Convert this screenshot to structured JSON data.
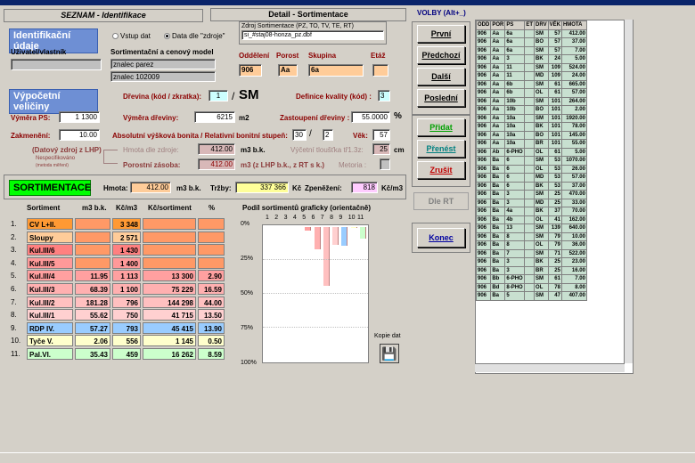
{
  "left_tab": "SEZNAM - Identifikace",
  "detail_tab": "Detail - Sortimentace",
  "voby": "VOLBY (Alt+_)",
  "ident": {
    "title": "Identifikační údaje",
    "radio1": "Vstup dat",
    "radio2": "Data dle \"zdroje\"",
    "source_label": "Zdroj Sortimentace (PZ, TO, TV, TE, RT)",
    "source_value": "si_#staj08-honza_pz.dbf",
    "owner_label": "Uživatel/vlastník",
    "owner_value": "",
    "model_label": "Sortimentační a cenový model",
    "model1": "znalec parez",
    "model2": "znalec 102009",
    "oddeleni_label": "Oddělení",
    "oddeleni": "906",
    "porost_label": "Porost",
    "porost": "Aa",
    "skupina_label": "Skupina",
    "skupina": "6a",
    "etaz_label": "Etáž",
    "etaz": ""
  },
  "calc": {
    "title": "Výpočetní veličiny",
    "drevina_label": "Dřevina (kód / zkratka):",
    "drevina_code": "1",
    "drevina_abbr": "SM",
    "kvalita_label": "Definice kvality (kód) :",
    "kvalita": "3",
    "vymera_ps_label": "Výměra PS:",
    "vymera_ps": "1 1300",
    "vymera_dr_label": "Výměra dřeviny:",
    "vymera_dr": "6215",
    "vymera_dr_unit": "m2",
    "zast_label": "Zastoupení dřeviny :",
    "zast": "55.0000",
    "zast_unit": "%",
    "zakmeneni_label": "Zakmenění:",
    "zakmeneni": "10.00",
    "bonita_label": "Absolutní výšková bonita / Relativní bonitní stupeň:",
    "bonita1": "30",
    "bonita2": "2",
    "vek_label": "Věk:",
    "vek": "57",
    "lhp_label": "(Datový zdroj z LHP)",
    "nespec": "Nespecifikováno",
    "metoda": "(metoda měření)",
    "hmota_zdroj_label": "Hmota dle zdroje:",
    "hmota_zdroj": "412.00",
    "hmota_zdroj_unit": "m3  b.k.",
    "tloustka_label": "Výčetní tloušťka tř1.3z:",
    "tloustka": "25",
    "tloustka_unit": "cm",
    "porostni_label": "Porostní zásoba:",
    "porostni": "412.00",
    "porostni_unit": "m3  (z LHP b.k., z RT s k.)",
    "metoria_label": "Metoria :"
  },
  "sort": {
    "title": "SORTIMENTACE",
    "hmota_label": "Hmota:",
    "hmota": "412.00",
    "hmota_unit": "m3 b.k.",
    "trzby_label": "Tržby:",
    "trzby": "337 366",
    "trzby_unit": "Kč",
    "zpen_label": "Zpeněžení:",
    "zpen": "818",
    "zpen_unit": "Kč/m3",
    "col_sort": "Sortiment",
    "col_m3": "m3 b.k.",
    "col_kcm3": "Kč/m3",
    "col_kcsort": "Kč/sortiment",
    "col_pct": "%",
    "graph_title": "Podíl sortimentů graficky (orientačně)",
    "kopie": "Kopie dat",
    "rows": [
      {
        "n": "1.",
        "name": "CV L+II.",
        "m3": "",
        "kc": "3 348",
        "kcs": "",
        "pct": "",
        "c": "#ff9933"
      },
      {
        "n": "2.",
        "name": "Sloupy",
        "m3": "",
        "kc": "2 571",
        "kcs": "",
        "pct": "",
        "c": "#ffcc99"
      },
      {
        "n": "3.",
        "name": "Kul.III/6",
        "m3": "",
        "kc": "1 430",
        "kcs": "",
        "pct": "",
        "c": "#ff8080"
      },
      {
        "n": "4.",
        "name": "Kul.III/5",
        "m3": "",
        "kc": "1 400",
        "kcs": "",
        "pct": "",
        "c": "#ff9999"
      },
      {
        "n": "5.",
        "name": "Kul.III/4",
        "m3": "11.95",
        "kc": "1 113",
        "kcs": "13 300",
        "pct": "2.90",
        "c": "#ffa0a0"
      },
      {
        "n": "6.",
        "name": "Kul.III/3",
        "m3": "68.39",
        "kc": "1 100",
        "kcs": "75 229",
        "pct": "16.59",
        "c": "#ffb0b0"
      },
      {
        "n": "7.",
        "name": "Kul.III/2",
        "m3": "181.28",
        "kc": "796",
        "kcs": "144 298",
        "pct": "44.00",
        "c": "#ffc0c0"
      },
      {
        "n": "8.",
        "name": "Kul.III/1",
        "m3": "55.62",
        "kc": "750",
        "kcs": "41 715",
        "pct": "13.50",
        "c": "#ffd0d0"
      },
      {
        "n": "9.",
        "name": "RDP IV.",
        "m3": "57.27",
        "kc": "793",
        "kcs": "45 415",
        "pct": "13.90",
        "c": "#99ccff"
      },
      {
        "n": "10.",
        "name": "Tyče V.",
        "m3": "2.06",
        "kc": "556",
        "kcs": "1 145",
        "pct": "0.50",
        "c": "#ffffcc"
      },
      {
        "n": "11.",
        "name": "Pal.VI.",
        "m3": "35.43",
        "kc": "459",
        "kcs": "16 262",
        "pct": "8.59",
        "c": "#ccffcc"
      }
    ],
    "graph_ticks": [
      "1",
      "2",
      "3",
      "4",
      "5",
      "6",
      "7",
      "8",
      "9",
      "10",
      "11"
    ],
    "y_ticks": [
      "0%",
      "25%",
      "50%",
      "75%",
      "100%"
    ]
  },
  "buttons": {
    "prvni": "První",
    "predchozi": "Předchozí",
    "dalsi": "Další",
    "posledni": "Poslední",
    "pridat": "Přidat",
    "prenest": "Přenést",
    "zrusit": "Zrušit",
    "dle_rt": "Dle RT",
    "konec": "Konec"
  },
  "grid": {
    "headers": [
      "ODD",
      "POR",
      "PS",
      "ET",
      "DRV",
      "VĚK",
      "HMOTA"
    ],
    "rows": [
      [
        "906",
        "Aa",
        "6a",
        "",
        "SM",
        "57",
        "412.00"
      ],
      [
        "906",
        "Aa",
        "6a",
        "",
        "BO",
        "57",
        "37.00"
      ],
      [
        "906",
        "Aa",
        "6a",
        "",
        "SM",
        "57",
        "7.00"
      ],
      [
        "906",
        "Aa",
        "3",
        "",
        "BK",
        "24",
        "5.00"
      ],
      [
        "906",
        "Aa",
        "11",
        "",
        "SM",
        "109",
        "524.00"
      ],
      [
        "906",
        "Aa",
        "11",
        "",
        "MD",
        "109",
        "24.00"
      ],
      [
        "906",
        "Aa",
        "6b",
        "",
        "SM",
        "61",
        "665.00"
      ],
      [
        "906",
        "Aa",
        "6b",
        "",
        "OL",
        "61",
        "57.00"
      ],
      [
        "906",
        "Aa",
        "10b",
        "",
        "SM",
        "101",
        "264.00"
      ],
      [
        "906",
        "Aa",
        "10b",
        "",
        "BO",
        "101",
        "2.00"
      ],
      [
        "906",
        "Aa",
        "10a",
        "",
        "SM",
        "101",
        "1920.00"
      ],
      [
        "906",
        "Aa",
        "10a",
        "",
        "BK",
        "101",
        "78.00"
      ],
      [
        "906",
        "Aa",
        "10a",
        "",
        "BO",
        "101",
        "145.00"
      ],
      [
        "906",
        "Aa",
        "10a",
        "",
        "BR",
        "101",
        "55.00"
      ],
      [
        "906",
        "Ab",
        "6-PHO",
        "",
        "OL",
        "61",
        "5.00"
      ],
      [
        "906",
        "Ba",
        "6",
        "",
        "SM",
        "53",
        "1070.00"
      ],
      [
        "906",
        "Ba",
        "6",
        "",
        "OL",
        "53",
        "26.00"
      ],
      [
        "906",
        "Ba",
        "6",
        "",
        "MD",
        "53",
        "57.00"
      ],
      [
        "906",
        "Ba",
        "6",
        "",
        "BK",
        "53",
        "37.00"
      ],
      [
        "906",
        "Ba",
        "3",
        "",
        "SM",
        "25",
        "470.00"
      ],
      [
        "906",
        "Ba",
        "3",
        "",
        "MD",
        "25",
        "33.00"
      ],
      [
        "906",
        "Ba",
        "4a",
        "",
        "BK",
        "37",
        "70.00"
      ],
      [
        "906",
        "Ba",
        "4b",
        "",
        "OL",
        "41",
        "162.00"
      ],
      [
        "906",
        "Ba",
        "13",
        "",
        "SM",
        "139",
        "640.00"
      ],
      [
        "906",
        "Ba",
        "8",
        "",
        "SM",
        "79",
        "10.00"
      ],
      [
        "906",
        "Ba",
        "8",
        "",
        "OL",
        "79",
        "36.00"
      ],
      [
        "906",
        "Ba",
        "7",
        "",
        "SM",
        "71",
        "522.00"
      ],
      [
        "906",
        "Ba",
        "3",
        "",
        "BK",
        "25",
        "23.00"
      ],
      [
        "906",
        "Ba",
        "3",
        "",
        "BR",
        "25",
        "16.00"
      ],
      [
        "906",
        "Bb",
        "6-PHO",
        "",
        "SM",
        "61",
        "7.00"
      ],
      [
        "906",
        "Bd",
        "8-PHO",
        "",
        "OL",
        "78",
        "8.00"
      ],
      [
        "906",
        "Ba",
        "5",
        "",
        "SM",
        "47",
        "407.00"
      ]
    ]
  }
}
